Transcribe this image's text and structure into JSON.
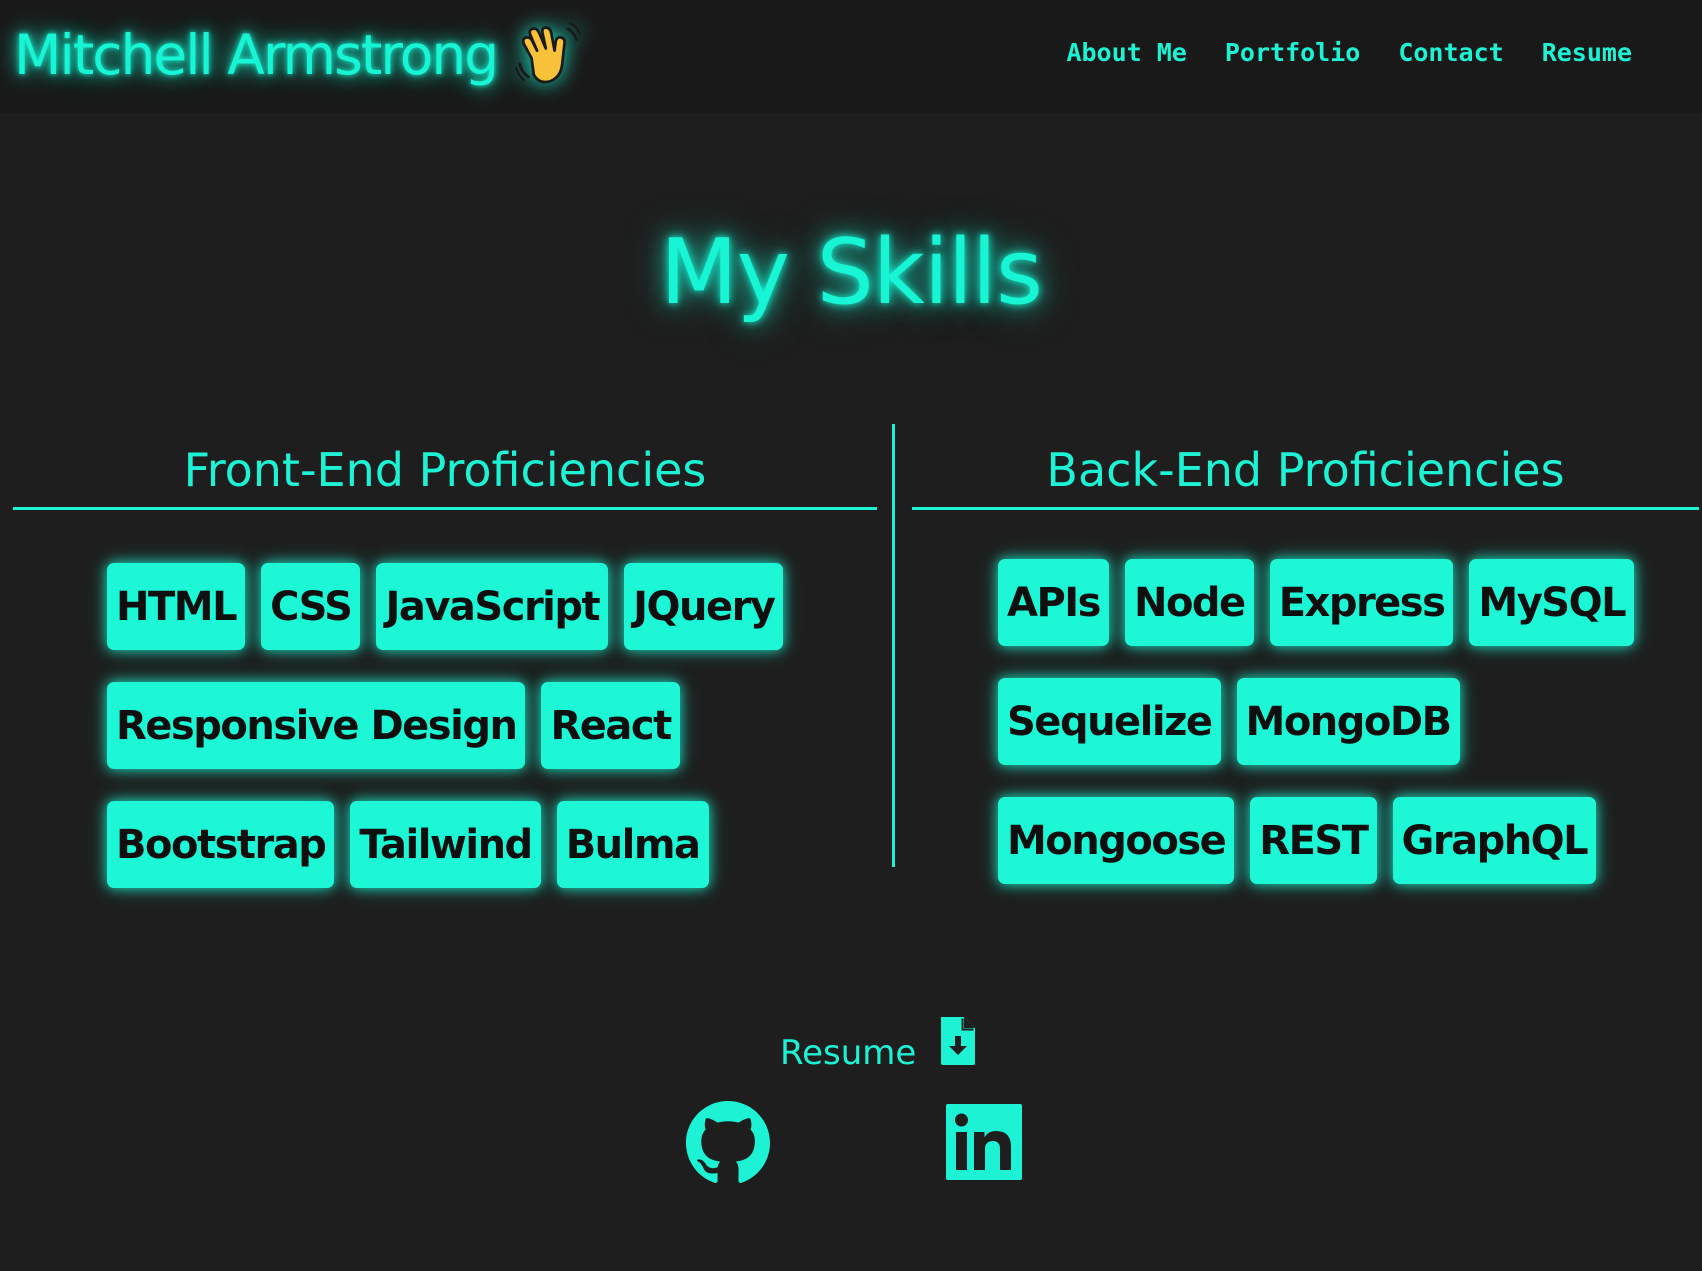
{
  "header": {
    "brand_name": "Mitchell Armstrong",
    "brand_emoji": "waving-hand-icon",
    "nav": [
      {
        "label": "About Me"
      },
      {
        "label": "Portfolio"
      },
      {
        "label": "Contact"
      },
      {
        "label": "Resume"
      }
    ]
  },
  "main": {
    "title": "My Skills",
    "front_end": {
      "heading": "Front-End Proficiencies",
      "skills": [
        "HTML",
        "CSS",
        "JavaScript",
        "JQuery",
        "Responsive Design",
        "React",
        "Bootstrap",
        "Tailwind",
        "Bulma"
      ]
    },
    "back_end": {
      "heading": "Back-End Proficiencies",
      "skills": [
        "APIs",
        "Node",
        "Express",
        "MySQL",
        "Sequelize",
        "MongoDB",
        "Mongoose",
        "REST",
        "GraphQL"
      ]
    }
  },
  "footer": {
    "resume_label": "Resume",
    "resume_icon": "file-download-icon",
    "social": [
      {
        "icon": "github-icon"
      },
      {
        "icon": "linkedin-icon"
      }
    ]
  },
  "colors": {
    "accent": "#1df2d4",
    "background": "#1e1e1e",
    "header_background": "#191919",
    "tag_text": "#0f0f0f"
  }
}
